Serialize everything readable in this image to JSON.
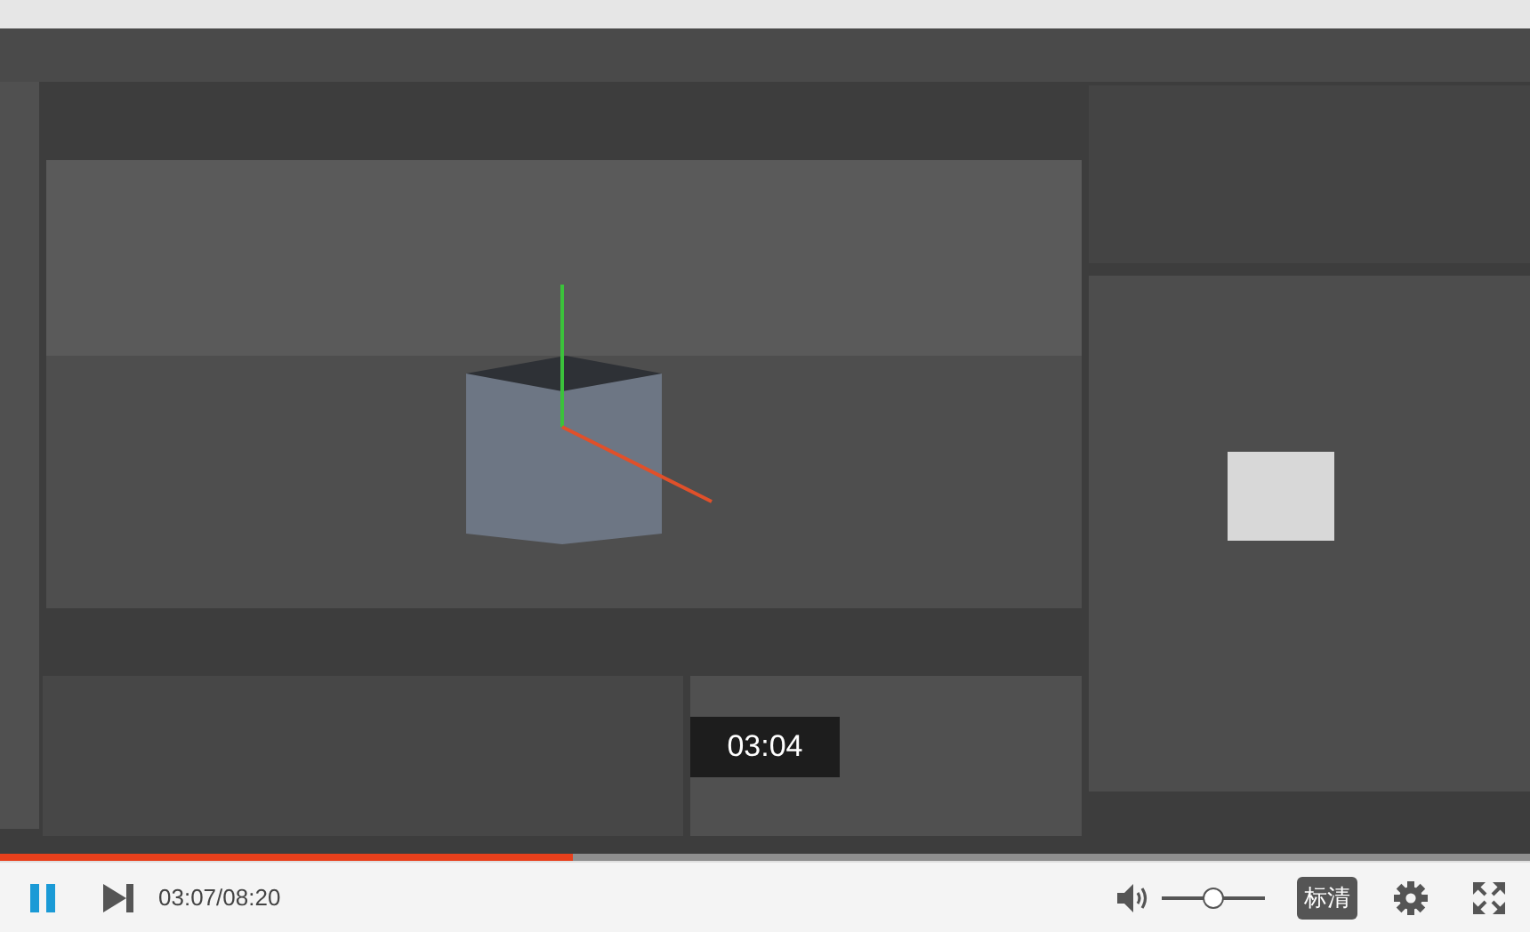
{
  "video": {
    "hover_time": "03:04"
  },
  "progress": {
    "level": 0.374
  },
  "controls": {
    "playing": true,
    "time": "03:07/08:20",
    "volume": {
      "level": 0.5
    },
    "quality": "标清"
  }
}
